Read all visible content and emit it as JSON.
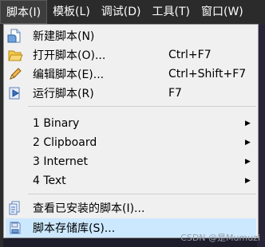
{
  "menubar": {
    "items": [
      {
        "label": "脚本(I)"
      },
      {
        "label": "模板(L)"
      },
      {
        "label": "调试(D)"
      },
      {
        "label": "工具(T)"
      },
      {
        "label": "窗口(W)"
      }
    ]
  },
  "menu": {
    "items": [
      {
        "label": "新建脚本(N)",
        "icon": "new-script-icon"
      },
      {
        "label": "打开脚本(O)...",
        "shortcut": "Ctrl+F7",
        "icon": "open-folder-icon"
      },
      {
        "label": "编辑脚本(E)...",
        "shortcut": "Ctrl+Shift+F7",
        "icon": "edit-pencil-icon"
      },
      {
        "label": "运行脚本(R)",
        "shortcut": "F7",
        "icon": "run-script-icon"
      },
      {
        "label": "1 Binary"
      },
      {
        "label": "2 Clipboard"
      },
      {
        "label": "3 Internet"
      },
      {
        "label": "4 Text"
      },
      {
        "label": "查看已安装的脚本(I)...",
        "icon": "installed-scripts-icon"
      },
      {
        "label": "脚本存储库(S)...",
        "icon": "script-repository-icon"
      }
    ]
  },
  "watermark": "CSDN @是Mumuzi",
  "colors": {
    "menubar_bg": "#2b2b2b",
    "menu_bg": "#f0f0f0",
    "highlight_bg": "#cce8ff"
  }
}
